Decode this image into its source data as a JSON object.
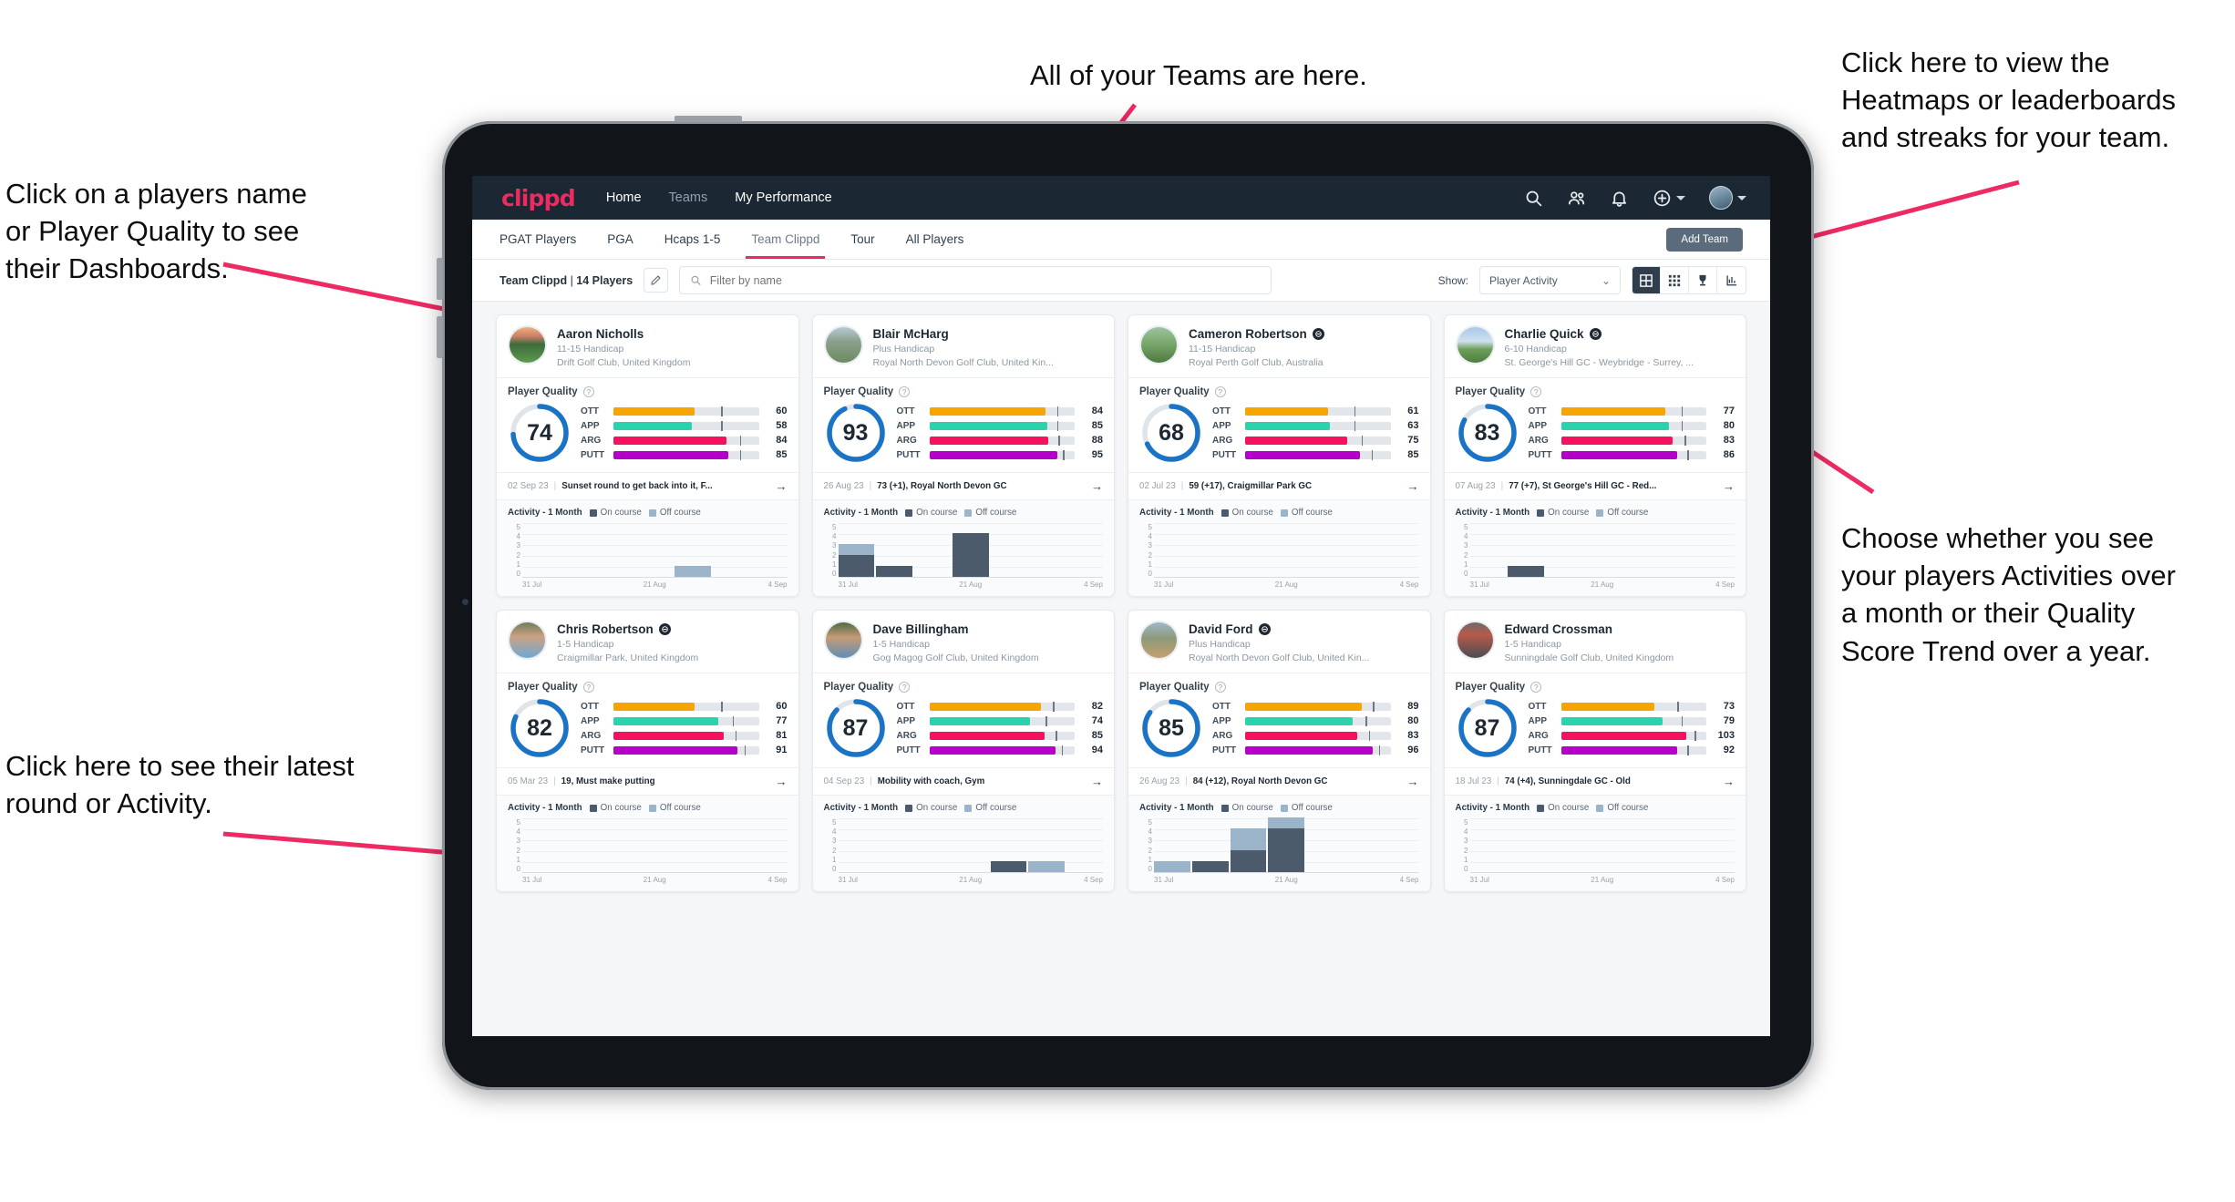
{
  "annotations": [
    {
      "id": "a-teams",
      "text": "All of your Teams are here."
    },
    {
      "id": "a-heatmaps",
      "text": "Click here to view the\nHeatmaps or leaderboards\nand streaks for your team."
    },
    {
      "id": "a-names",
      "text": "Click on a players name\nor Player Quality to see\ntheir Dashboards."
    },
    {
      "id": "a-activity",
      "text": "Choose whether you see\nyour players Activities over\na month or their Quality\nScore Trend over a year."
    },
    {
      "id": "a-latest",
      "text": "Click here to see their latest\nround or Activity."
    }
  ],
  "navbar": {
    "brand": "clippd",
    "links": [
      {
        "label": "Home",
        "active": true
      },
      {
        "label": "Teams",
        "active": false
      },
      {
        "label": "My Performance",
        "active": true
      }
    ],
    "icons": [
      "search-icon",
      "people-icon",
      "bell-icon",
      "plus-circle-icon",
      "avatar"
    ]
  },
  "tabs": {
    "items": [
      {
        "label": "PGAT Players",
        "active": false
      },
      {
        "label": "PGA",
        "active": false
      },
      {
        "label": "Hcaps 1-5",
        "active": false
      },
      {
        "label": "Team Clippd",
        "active": true
      },
      {
        "label": "Tour",
        "active": false
      },
      {
        "label": "All Players",
        "active": false
      }
    ],
    "add_team_label": "Add Team"
  },
  "filter_bar": {
    "team_name": "Team Clippd",
    "team_count": "14 Players",
    "search_placeholder": "Filter by name",
    "search_value": "",
    "show_label": "Show:",
    "show_value": "Player Activity",
    "show_options": [
      "Player Activity",
      "Quality Score Trend"
    ],
    "view_buttons": [
      "grid-large-icon",
      "grid-small-icon",
      "trophy-icon",
      "chart-icon"
    ]
  },
  "colors": {
    "accent_pink": "#ee2a62",
    "navbar_bg": "#1b2733",
    "ring_blue": "#1a73c4",
    "ott": "#f5a400",
    "app": "#2ad3ab",
    "arg": "#f5115e",
    "putt": "#b400c8",
    "on_course": "#4b5b6b",
    "off_course": "#9cb4c9"
  },
  "card_labels": {
    "player_quality": "Player Quality",
    "activity": "Activity - 1 Month",
    "legend_on": "On course",
    "legend_off": "Off course",
    "metrics": [
      "OTT",
      "APP",
      "ARG",
      "PUTT"
    ],
    "y_ticks": [
      "5",
      "4",
      "3",
      "2",
      "1",
      "0"
    ],
    "x_ticks": [
      "31 Jul",
      "21 Aug",
      "4 Sep"
    ]
  },
  "players": [
    {
      "name": "Aaron Nicholls",
      "verified": false,
      "handicap": "11-15 Handicap",
      "club": "Drift Golf Club, United Kingdom",
      "quality": 74,
      "avatar_style": "sunset-course",
      "metrics": [
        {
          "label": "OTT",
          "value": 60,
          "fill": 56,
          "tick": 74
        },
        {
          "label": "APP",
          "value": 58,
          "fill": 54,
          "tick": 74
        },
        {
          "label": "ARG",
          "value": 84,
          "fill": 78,
          "tick": 87
        },
        {
          "label": "PUTT",
          "value": 85,
          "fill": 79,
          "tick": 87
        }
      ],
      "latest": {
        "date": "02 Sep 23",
        "text": "Sunset round to get back into it, F..."
      },
      "chart": {
        "on": [
          0,
          0,
          0,
          0,
          0,
          0,
          0
        ],
        "off": [
          0,
          0,
          0,
          0,
          1,
          0,
          0
        ]
      }
    },
    {
      "name": "Blair McHarg",
      "verified": false,
      "handicap": "Plus Handicap",
      "club": "Royal North Devon Golf Club, United Kin...",
      "quality": 93,
      "avatar_style": "links",
      "metrics": [
        {
          "label": "OTT",
          "value": 84,
          "fill": 80,
          "tick": 88
        },
        {
          "label": "APP",
          "value": 85,
          "fill": 81,
          "tick": 88
        },
        {
          "label": "ARG",
          "value": 88,
          "fill": 82,
          "tick": 89
        },
        {
          "label": "PUTT",
          "value": 95,
          "fill": 88,
          "tick": 92
        }
      ],
      "latest": {
        "date": "26 Aug 23",
        "text": "73 (+1), Royal North Devon GC"
      },
      "chart": {
        "on": [
          2,
          1,
          0,
          4,
          0,
          0,
          0
        ],
        "off": [
          1,
          0,
          0,
          0,
          0,
          0,
          0
        ]
      }
    },
    {
      "name": "Cameron Robertson",
      "verified": true,
      "handicap": "11-15 Handicap",
      "club": "Royal Perth Golf Club, Australia",
      "quality": 68,
      "avatar_style": "fairway",
      "metrics": [
        {
          "label": "OTT",
          "value": 61,
          "fill": 57,
          "tick": 75
        },
        {
          "label": "APP",
          "value": 63,
          "fill": 58,
          "tick": 75
        },
        {
          "label": "ARG",
          "value": 75,
          "fill": 70,
          "tick": 80
        },
        {
          "label": "PUTT",
          "value": 85,
          "fill": 79,
          "tick": 87
        }
      ],
      "latest": {
        "date": "02 Jul 23",
        "text": "59 (+17), Craigmillar Park GC"
      },
      "chart": {
        "on": [
          0,
          0,
          0,
          0,
          0,
          0,
          0
        ],
        "off": [
          0,
          0,
          0,
          0,
          0,
          0,
          0
        ]
      }
    },
    {
      "name": "Charlie Quick",
      "verified": true,
      "handicap": "6-10 Handicap",
      "club": "St. George's Hill GC - Weybridge - Surrey, ...",
      "quality": 83,
      "avatar_style": "green",
      "metrics": [
        {
          "label": "OTT",
          "value": 77,
          "fill": 72,
          "tick": 83
        },
        {
          "label": "APP",
          "value": 80,
          "fill": 74,
          "tick": 83
        },
        {
          "label": "ARG",
          "value": 83,
          "fill": 77,
          "tick": 85
        },
        {
          "label": "PUTT",
          "value": 86,
          "fill": 80,
          "tick": 87
        }
      ],
      "latest": {
        "date": "07 Aug 23",
        "text": "77 (+7), St George's Hill GC - Red..."
      },
      "chart": {
        "on": [
          0,
          1,
          0,
          0,
          0,
          0,
          0
        ],
        "off": [
          0,
          0,
          0,
          0,
          0,
          0,
          0
        ]
      }
    },
    {
      "name": "Chris Robertson",
      "verified": true,
      "handicap": "1-5 Handicap",
      "club": "Craigmillar Park, United Kingdom",
      "quality": 82,
      "avatar_style": "portrait-a",
      "metrics": [
        {
          "label": "OTT",
          "value": 60,
          "fill": 56,
          "tick": 74
        },
        {
          "label": "APP",
          "value": 77,
          "fill": 72,
          "tick": 82
        },
        {
          "label": "ARG",
          "value": 81,
          "fill": 76,
          "tick": 84
        },
        {
          "label": "PUTT",
          "value": 91,
          "fill": 85,
          "tick": 90
        }
      ],
      "latest": {
        "date": "05 Mar 23",
        "text": "19, Must make putting"
      },
      "chart": {
        "on": [
          0,
          0,
          0,
          0,
          0,
          0,
          0
        ],
        "off": [
          0,
          0,
          0,
          0,
          0,
          0,
          0
        ]
      }
    },
    {
      "name": "Dave Billingham",
      "verified": false,
      "handicap": "1-5 Handicap",
      "club": "Gog Magog Golf Club, United Kingdom",
      "quality": 87,
      "avatar_style": "portrait-b",
      "metrics": [
        {
          "label": "OTT",
          "value": 82,
          "fill": 77,
          "tick": 85
        },
        {
          "label": "APP",
          "value": 74,
          "fill": 69,
          "tick": 80
        },
        {
          "label": "ARG",
          "value": 85,
          "fill": 79,
          "tick": 87
        },
        {
          "label": "PUTT",
          "value": 94,
          "fill": 87,
          "tick": 91
        }
      ],
      "latest": {
        "date": "04 Sep 23",
        "text": "Mobility with coach, Gym"
      },
      "chart": {
        "on": [
          0,
          0,
          0,
          0,
          1,
          0,
          0
        ],
        "off": [
          0,
          0,
          0,
          0,
          0,
          1,
          0
        ]
      }
    },
    {
      "name": "David Ford",
      "verified": true,
      "handicap": "Plus Handicap",
      "club": "Royal North Devon Golf Club, United Kin...",
      "quality": 85,
      "avatar_style": "coast",
      "metrics": [
        {
          "label": "OTT",
          "value": 89,
          "fill": 80,
          "tick": 88
        },
        {
          "label": "APP",
          "value": 80,
          "fill": 74,
          "tick": 83
        },
        {
          "label": "ARG",
          "value": 83,
          "fill": 77,
          "tick": 85
        },
        {
          "label": "PUTT",
          "value": 96,
          "fill": 88,
          "tick": 92
        }
      ],
      "latest": {
        "date": "26 Aug 23",
        "text": "84 (+12), Royal North Devon GC"
      },
      "chart": {
        "on": [
          0,
          1,
          2,
          4,
          0,
          0,
          0
        ],
        "off": [
          1,
          0,
          2,
          1,
          0,
          0,
          0
        ]
      }
    },
    {
      "name": "Edward Crossman",
      "verified": false,
      "handicap": "1-5 Handicap",
      "club": "Sunningdale Golf Club, United Kingdom",
      "quality": 87,
      "avatar_style": "indoor",
      "metrics": [
        {
          "label": "OTT",
          "value": 73,
          "fill": 64,
          "tick": 80
        },
        {
          "label": "APP",
          "value": 79,
          "fill": 70,
          "tick": 83
        },
        {
          "label": "ARG",
          "value": 103,
          "fill": 86,
          "tick": 92
        },
        {
          "label": "PUTT",
          "value": 92,
          "fill": 80,
          "tick": 87
        }
      ],
      "latest": {
        "date": "18 Jul 23",
        "text": "74 (+4), Sunningdale GC - Old"
      },
      "chart": {
        "on": [
          0,
          0,
          0,
          0,
          0,
          0,
          0
        ],
        "off": [
          0,
          0,
          0,
          0,
          0,
          0,
          0
        ]
      }
    }
  ]
}
